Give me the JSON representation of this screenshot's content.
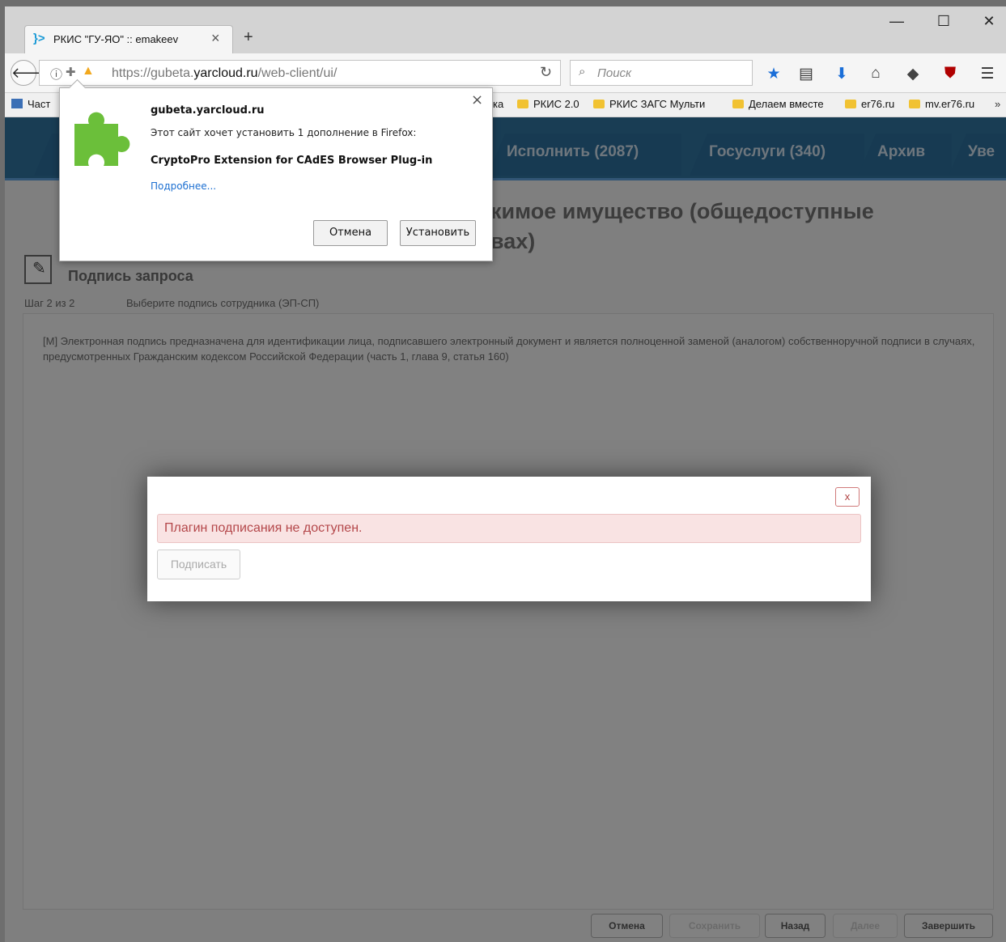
{
  "browser": {
    "tab": {
      "favicon": "}>",
      "title": "РКИС \"ГУ-ЯО\" :: emakeev",
      "close": "×"
    },
    "new_tab": "+",
    "window_controls": {
      "minimize": "—",
      "maximize": "☐",
      "close": "✕"
    },
    "back": "🡐",
    "url": {
      "prefix": "https://gubeta.",
      "domain": "yarcloud.ru",
      "path": "/web-client/ui/"
    },
    "search_placeholder": "Поиск",
    "bookmarks": [
      "Част",
      "ка",
      "РКИС 2.0",
      "РКИС ЗАГС Мульти",
      "Делаем вместе",
      "er76.ru",
      "mv.er76.ru"
    ],
    "bookmarks_overflow": "»"
  },
  "addon_popup": {
    "site": "gubeta.yarcloud.ru",
    "message": "Этот сайт хочет установить 1 дополнение в Firefox:",
    "addon_name": "CryptoPro Extension for CAdES Browser Plug-in",
    "more_link": "Подробнее...",
    "cancel": "Отмена",
    "install": "Установить",
    "close": "×"
  },
  "app": {
    "nav_tabs": [
      "Исполнить (2087)",
      "Госуслуги (340)",
      "Архив",
      "Уве"
    ],
    "heading_line1": "кимое имущество (общедоступные",
    "heading_line2": "вах)",
    "step_title": "Подпись запроса",
    "step_number": "Шаг 2 из 2",
    "step_description": "Выберите подпись сотрудника (ЭП-СП)",
    "note": "[M] Электронная подпись предназначена для идентификации лица, подписавшего электронный документ и является полноценной заменой (аналогом) собственноручной подписи в случаях, предусмотренных Гражданским кодексом Российской Федерации (часть 1, глава 9, статья 160)",
    "footer_buttons": {
      "cancel": "Отмена",
      "save": "Сохранить",
      "back": "Назад",
      "next": "Далее",
      "finish": "Завершить"
    }
  },
  "sign_modal": {
    "close": "x",
    "error": "Плагин подписания не доступен.",
    "sign_button": "Подписать"
  }
}
